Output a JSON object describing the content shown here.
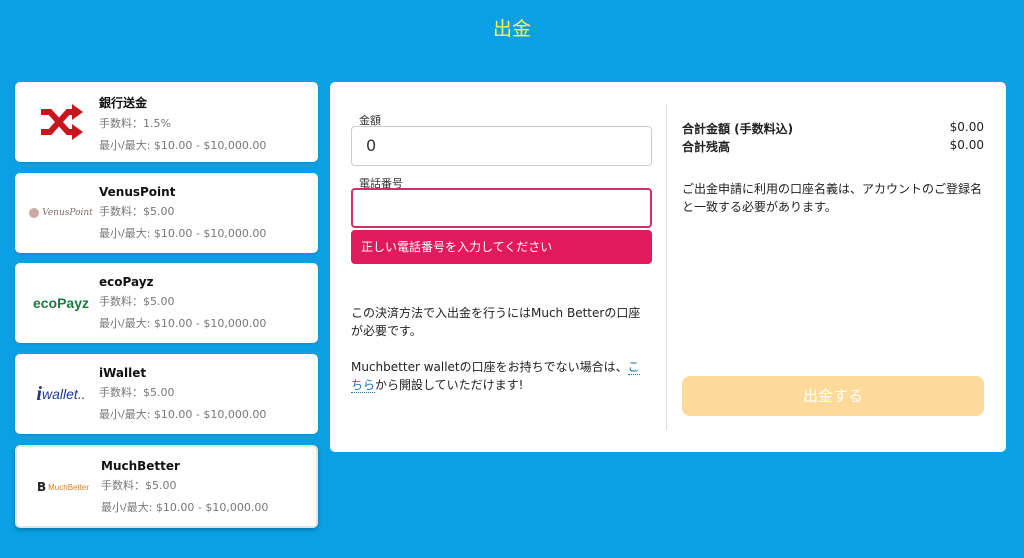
{
  "header": {
    "title": "出金"
  },
  "methods": [
    {
      "name": "銀行送金",
      "fee": "手数料：1.5%",
      "range": "最小/最大: $10.00 - $10,000.00",
      "icon": "shuffle-icon"
    },
    {
      "name": "VenusPoint",
      "fee": "手数料：$5.00",
      "range": "最小/最大: $10.00 - $10,000.00",
      "logo_text": "VenusPoint"
    },
    {
      "name": "ecoPayz",
      "fee": "手数料：$5.00",
      "range": "最小/最大: $10.00 - $10,000.00",
      "logo_text": "ecoPayz"
    },
    {
      "name": "iWallet",
      "fee": "手数料：$5.00",
      "range": "最小/最大: $10.00 - $10,000.00",
      "logo_text": "wallet.."
    },
    {
      "name": "MuchBetter",
      "fee": "手数料：$5.00",
      "range": "最小/最大: $10.00 - $10,000.00",
      "logo_text": "MuchBetter"
    }
  ],
  "form": {
    "amount_label": "金額",
    "amount_value": "0",
    "phone_label": "電話番号",
    "phone_value": "",
    "phone_error": "正しい電話番号を入力してください",
    "note1": "この決済方法で入出金を行うにはMuch Betterの口座が必要です。",
    "note2_pre": "Muchbetter walletの口座をお持ちでない場合は、",
    "note2_link": "こちら",
    "note2_post": "から開設していただけます!"
  },
  "summary": {
    "total_label": "合計金額 (手数料込)",
    "total_value": "$0.00",
    "balance_label": "合計残高",
    "balance_value": "$0.00",
    "notice": "ご出金申請に利用の口座名義は、アカウントのご登録名と一致する必要があります。",
    "submit_label": "出金する"
  },
  "colors": {
    "background": "#0aa0e3",
    "title": "#fff15a",
    "error": "#e3195e",
    "submit": "#fdd99a"
  }
}
